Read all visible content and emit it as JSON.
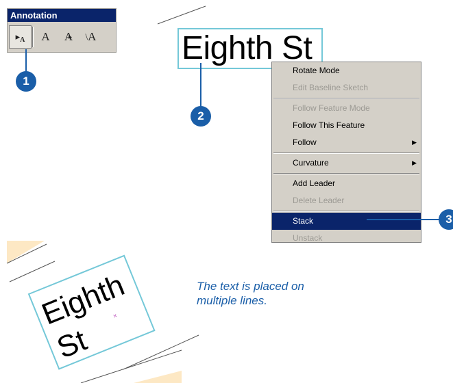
{
  "toolbar": {
    "title": "Annotation",
    "tools": [
      {
        "name": "select-annotation-tool",
        "glyph": "▸A"
      },
      {
        "name": "horizontal-annotation-tool",
        "glyph": "A"
      },
      {
        "name": "curved-annotation-tool",
        "glyph": "A"
      },
      {
        "name": "leader-annotation-tool",
        "glyph": "A"
      }
    ]
  },
  "callouts": {
    "one": "1",
    "two": "2",
    "three": "3"
  },
  "label_top": {
    "text": "Eighth St"
  },
  "label_bottom": {
    "line1": "Eighth",
    "line2": "St"
  },
  "context_menu": {
    "items": [
      {
        "label": "Rotate Mode",
        "disabled": false
      },
      {
        "label": "Edit Baseline Sketch",
        "disabled": true
      },
      {
        "label": "Follow Feature Mode",
        "disabled": true
      },
      {
        "label": "Follow This Feature",
        "disabled": false
      },
      {
        "label": "Follow",
        "disabled": false,
        "submenu": true
      },
      {
        "label": "Curvature",
        "disabled": false,
        "submenu": true
      },
      {
        "label": "Add Leader",
        "disabled": false
      },
      {
        "label": "Delete Leader",
        "disabled": true
      },
      {
        "label": "Stack",
        "disabled": false,
        "highlighted": true
      },
      {
        "label": "Unstack",
        "disabled": true
      }
    ]
  },
  "caption": "The text is placed on multiple lines.",
  "colors": {
    "accent": "#1a5ea8",
    "label_box": "#74c8d8",
    "menu_highlight": "#0a246a",
    "parcel": "#fde8c4"
  }
}
